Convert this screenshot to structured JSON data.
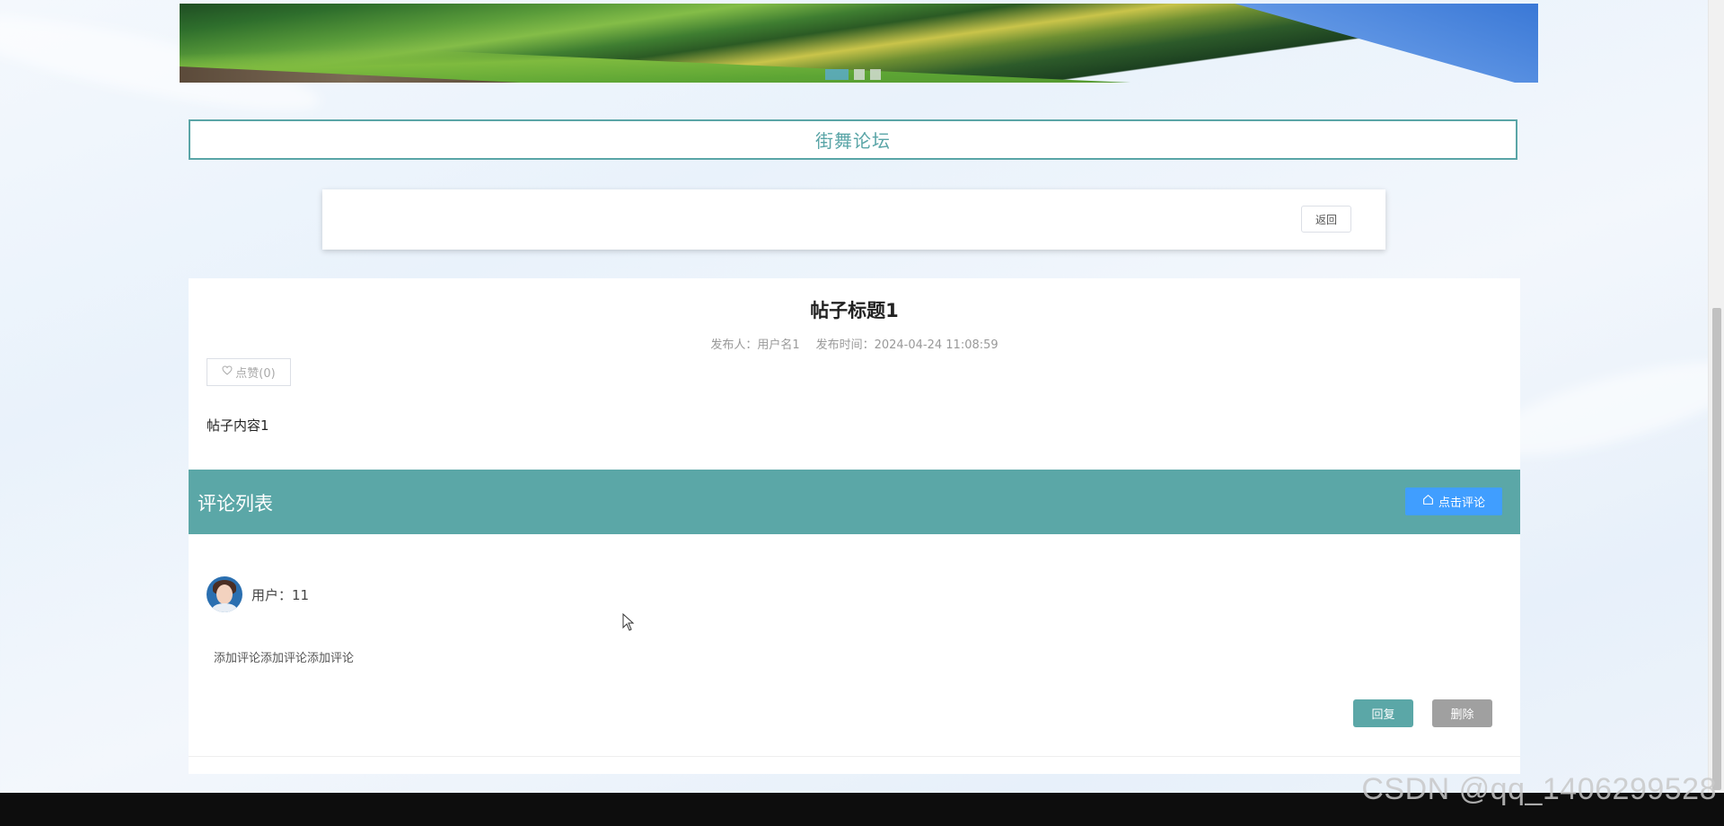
{
  "banner": {
    "slides": 3,
    "active_slide": 1
  },
  "forum": {
    "title": "街舞论坛"
  },
  "nav": {
    "back_label": "返回"
  },
  "post": {
    "title": "帖子标题1",
    "author_label": "发布人：用户名1",
    "time_label": "发布时间：2024-04-24 11:08:59",
    "like_label": "点赞(0)",
    "content": "帖子内容1"
  },
  "comments": {
    "header": "评论列表",
    "add_label": "点击评论",
    "items": [
      {
        "user_label": "用户：11",
        "text": "添加评论添加评论添加评论",
        "reply_label": "回复",
        "delete_label": "删除"
      }
    ]
  },
  "watermark": "CSDN @qq_1406299528",
  "colors": {
    "accent": "#5ba7a7",
    "primary_button": "#409eff",
    "delete_button": "#a0a0a0"
  }
}
